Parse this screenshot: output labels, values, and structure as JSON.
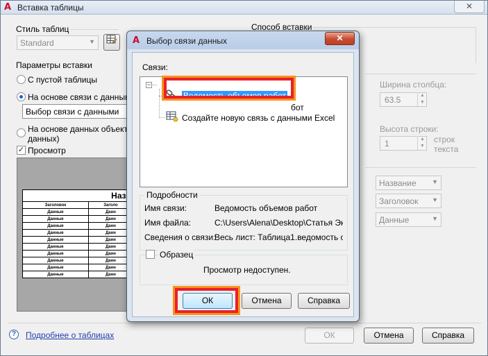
{
  "outer": {
    "title": "Вставка таблицы",
    "close": "✕",
    "table_style_label": "Стиль таблиц",
    "table_style_value": "Standard",
    "insert_params_label": "Параметры вставки",
    "opt_empty": "С пустой таблицы",
    "opt_datalink": "На основе связи с данными",
    "datalink_combo": "Выбор связи с данными",
    "opt_object_line1": "На основе данных объекта в",
    "opt_object_line2": "данных)",
    "preview_label": "Просмотр",
    "preview_check": "✓",
    "insert_method_label": "Способ вставки",
    "col_width_label": "Ширина столбца:",
    "col_width_value": "63.5",
    "row_height_label": "Высота строки:",
    "row_height_value": "1",
    "row_unit_1": "строк",
    "row_unit_2": "текста",
    "style_name": "Название",
    "style_header": "Заголовок",
    "style_data": "Данные",
    "help_link": "Подробнее о таблицах",
    "help_glyph": "?",
    "ok": "ОК",
    "cancel": "Отмена",
    "help": "Справка",
    "preview_table": {
      "title": "Назв",
      "header": [
        "Заголовок",
        "Заголо"
      ],
      "cell": [
        "Данные",
        "Данн"
      ]
    }
  },
  "modal": {
    "title": "Выбор связи данных",
    "close": "✕",
    "links_label": "Связи:",
    "tree_toggle": "−",
    "link_selected": "Ведомость объемов работ",
    "link_hidden_tail": "бот",
    "link_create_excel": "Создайте новую связь с данными Excel",
    "details_label": "Подробности",
    "details": [
      {
        "key": "Имя связи:",
        "value": "Ведомость объемов работ"
      },
      {
        "key": "Имя файла:",
        "value": "C:\\Users\\Alena\\Desktop\\Статья Эк..."
      },
      {
        "key": "Сведения о связи:",
        "value": "Весь лист: Таблица1.ведомость о..."
      }
    ],
    "sample_label": "Образец",
    "sample_text": "Просмотр недоступен.",
    "ok": "ОК",
    "cancel": "Отмена",
    "help": "Справка"
  },
  "colors": {
    "highlight_red": "#e8212a",
    "highlight_orange": "#f7941d",
    "selection_blue": "#3399ff",
    "close_red": "#c84a30"
  }
}
